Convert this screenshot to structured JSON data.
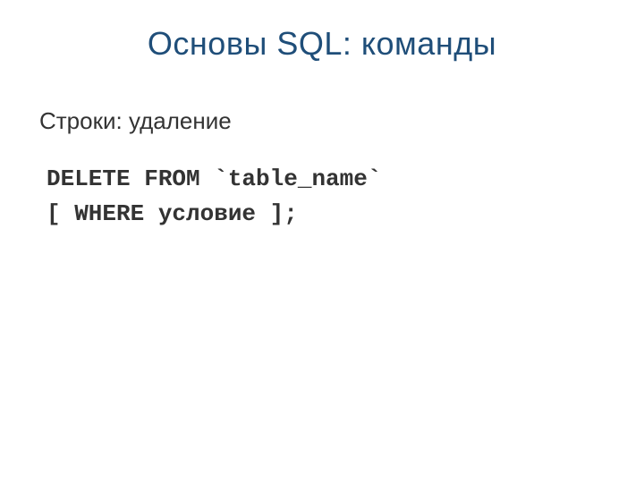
{
  "slide": {
    "title": "Основы SQL: команды",
    "subtitle": "Строки: удаление",
    "code": {
      "line1": "DELETE FROM `table_name`",
      "line2": "[ WHERE условие ];"
    }
  }
}
